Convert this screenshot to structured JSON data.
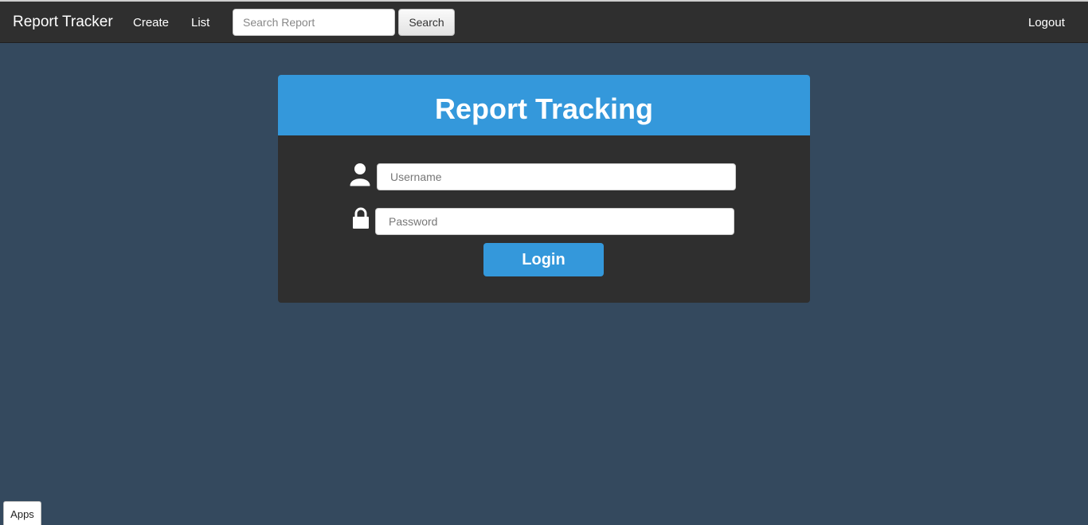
{
  "navbar": {
    "brand": "Report Tracker",
    "links": {
      "create": "Create",
      "list": "List"
    },
    "search": {
      "placeholder": "Search Report",
      "value": "",
      "button_label": "Search"
    },
    "logout": "Logout"
  },
  "login_card": {
    "title": "Report Tracking",
    "username": {
      "icon": "user-icon",
      "placeholder": "Username",
      "value": ""
    },
    "password": {
      "icon": "lock-icon",
      "placeholder": "Password",
      "value": ""
    },
    "login_label": "Login"
  },
  "taskbar": {
    "apps_label": "Apps"
  },
  "colors": {
    "navbar_bg": "#2f2f2f",
    "page_bg": "#34495e",
    "accent": "#3498db",
    "card_bg": "#2f2f2f"
  }
}
